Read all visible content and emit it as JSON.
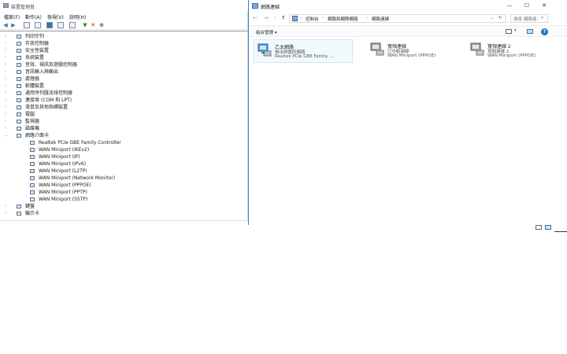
{
  "device_manager": {
    "title": "裝置管理員",
    "menu": [
      "檔案(F)",
      "動作(A)",
      "檢視(V)",
      "說明(H)"
    ],
    "tree": [
      {
        "label": "列印佇列",
        "level": 1,
        "expander": "›"
      },
      {
        "label": "存放控制器",
        "level": 1,
        "expander": "›"
      },
      {
        "label": "安全性裝置",
        "level": 1,
        "expander": "›"
      },
      {
        "label": "系統裝置",
        "level": 1,
        "expander": "›"
      },
      {
        "label": "音效、視訊及遊戲控制器",
        "level": 1,
        "expander": "›"
      },
      {
        "label": "音訊輸入與輸出",
        "level": 1,
        "expander": "›"
      },
      {
        "label": "處理器",
        "level": 1,
        "expander": "›"
      },
      {
        "label": "軟體裝置",
        "level": 1,
        "expander": "›"
      },
      {
        "label": "通用序列匯流排控制器",
        "level": 1,
        "expander": "›"
      },
      {
        "label": "連接埠 (COM 和 LPT)",
        "level": 1,
        "expander": "›"
      },
      {
        "label": "滑鼠及其他指標裝置",
        "level": 1,
        "expander": "›"
      },
      {
        "label": "電腦",
        "level": 1,
        "expander": "›"
      },
      {
        "label": "監視器",
        "level": 1,
        "expander": "›"
      },
      {
        "label": "磁碟機",
        "level": 1,
        "expander": "›"
      },
      {
        "label": "網路介面卡",
        "level": 1,
        "expander": "⌄"
      },
      {
        "label": "Realtek PCIe GBE Family Controller",
        "level": 2,
        "expander": ""
      },
      {
        "label": "WAN Miniport (IKEv2)",
        "level": 2,
        "expander": ""
      },
      {
        "label": "WAN Miniport (IP)",
        "level": 2,
        "expander": ""
      },
      {
        "label": "WAN Miniport (IPv6)",
        "level": 2,
        "expander": ""
      },
      {
        "label": "WAN Miniport (L2TP)",
        "level": 2,
        "expander": ""
      },
      {
        "label": "WAN Miniport (Network Monitor)",
        "level": 2,
        "expander": ""
      },
      {
        "label": "WAN Miniport (PPPOE)",
        "level": 2,
        "expander": ""
      },
      {
        "label": "WAN Miniport (PPTP)",
        "level": 2,
        "expander": ""
      },
      {
        "label": "WAN Miniport (SSTP)",
        "level": 2,
        "expander": ""
      },
      {
        "label": "鍵盤",
        "level": 1,
        "expander": "›"
      },
      {
        "label": "顯示卡",
        "level": 1,
        "expander": "›"
      }
    ]
  },
  "network_connections": {
    "title": "網路連線",
    "window_buttons": {
      "minimize": "—",
      "maximize": "☐",
      "close": "✕"
    },
    "breadcrumb": [
      "控制台",
      "網路和網際網路",
      "網路連線"
    ],
    "search_placeholder": "搜尋 網路連...",
    "organize_label": "組合管理 ▾",
    "connections": [
      {
        "name": "乙太網路",
        "status": "無法辨識的網路",
        "device": "Realtek PCIe GBE Family ...",
        "selected": true
      },
      {
        "name": "寬頻連線",
        "status": "已中斷連線",
        "device": "WAN Miniport (PPPOE)",
        "selected": false
      },
      {
        "name": "寬頻連線 2",
        "status": "寬頻連線 2",
        "device": "WAN Miniport (PPPOE)",
        "selected": false
      }
    ]
  },
  "colors": {
    "accent": "#3b82d0",
    "selected_bg": "#f2f9fd"
  }
}
